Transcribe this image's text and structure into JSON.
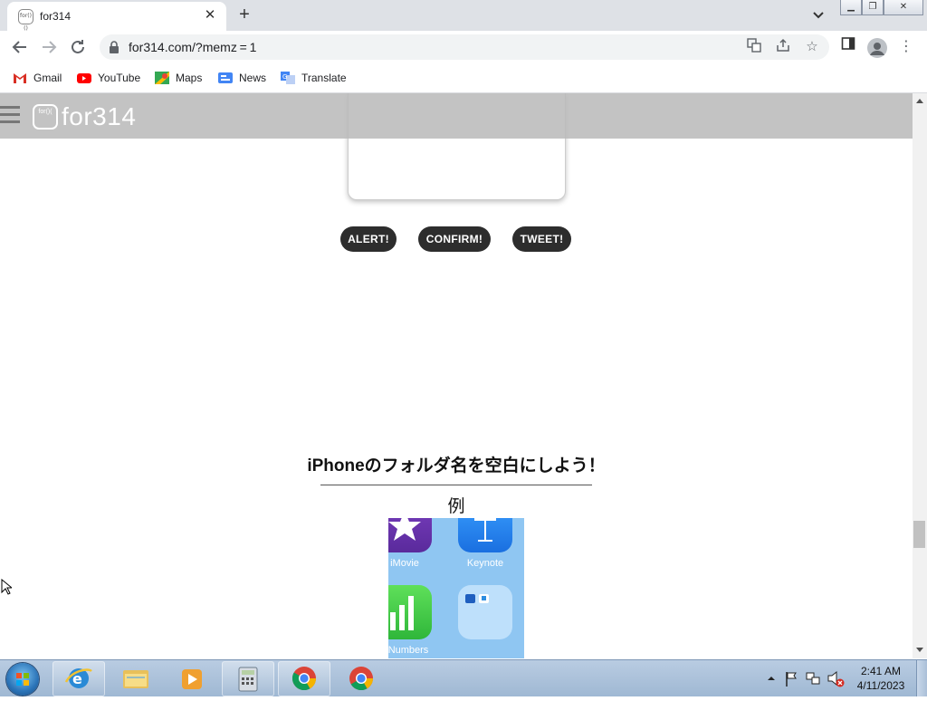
{
  "browser": {
    "tab": {
      "title": "for314",
      "favicon_text": "for()()"
    },
    "url": "for314.com/?memz = 1",
    "bookmarks": [
      {
        "label": "Gmail",
        "icon": "gmail-icon"
      },
      {
        "label": "YouTube",
        "icon": "youtube-icon"
      },
      {
        "label": "Maps",
        "icon": "maps-icon"
      },
      {
        "label": "News",
        "icon": "news-icon"
      },
      {
        "label": "Translate",
        "icon": "translate-icon"
      }
    ]
  },
  "site": {
    "logo_text": "for()(",
    "name": "for314",
    "buttons": {
      "alert": "ALERT!",
      "confirm": "CONFIRM!",
      "tweet": "TWEET!"
    },
    "heading": "iPhoneのフォルダ名を空白にしよう！",
    "example_label": "例",
    "phone_apps": [
      {
        "label": "iMovie"
      },
      {
        "label": "Keynote"
      },
      {
        "label": "Numbers"
      }
    ]
  },
  "taskbar": {
    "clock_time": "2:41 AM",
    "clock_date": "4/11/2023"
  },
  "colors": {
    "pill": "#2d2d2d",
    "sitebar": "#b9b9b9",
    "phone_bg": "#8fc6f2"
  }
}
